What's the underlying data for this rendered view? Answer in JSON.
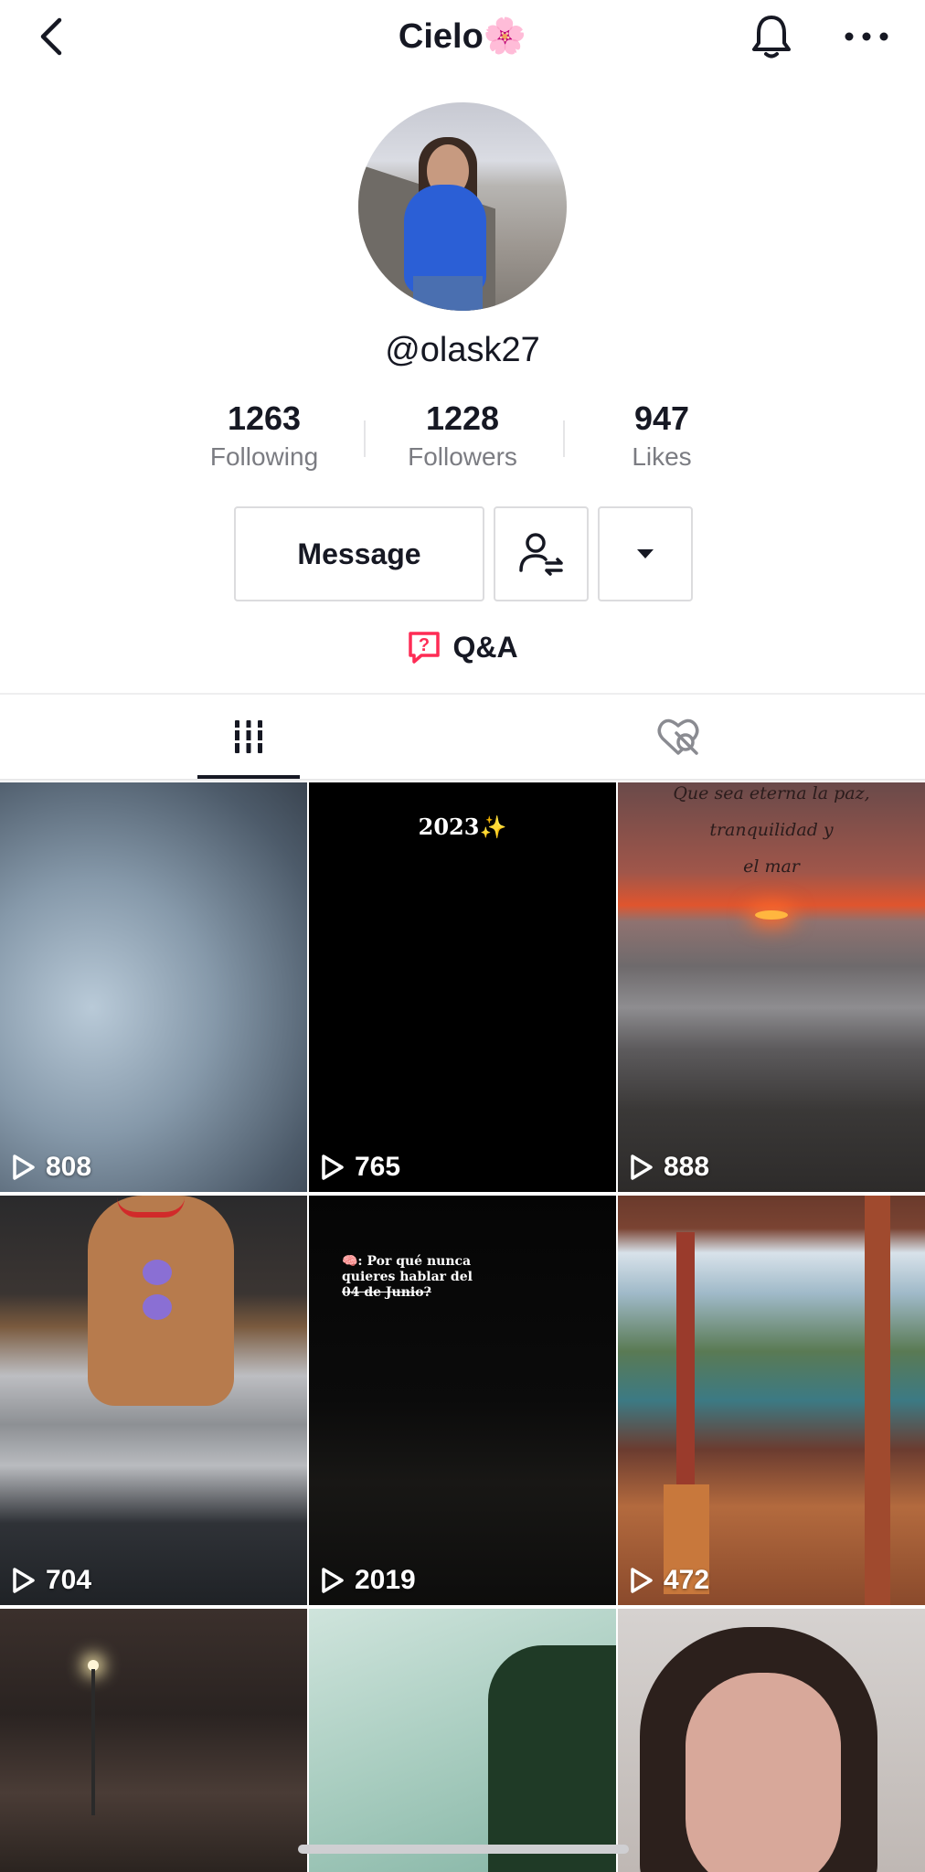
{
  "header": {
    "title": "Cielo🌸"
  },
  "profile": {
    "username": "@olask27",
    "stats": [
      {
        "value": "1263",
        "label": "Following"
      },
      {
        "value": "1228",
        "label": "Followers"
      },
      {
        "value": "947",
        "label": "Likes"
      }
    ]
  },
  "actions": {
    "message_label": "Message",
    "qa_label": "Q&A"
  },
  "tabs": [
    {
      "icon": "grid-icon",
      "active": true
    },
    {
      "icon": "liked-hidden-icon",
      "active": false
    }
  ],
  "videos": [
    {
      "views": "808",
      "overlay": ""
    },
    {
      "views": "765",
      "overlay": "2023✨"
    },
    {
      "views": "888",
      "overlay_lines": [
        "Que sea eterna la paz,",
        "tranquilidad y",
        "el mar"
      ]
    },
    {
      "views": "704",
      "overlay": ""
    },
    {
      "views": "2019",
      "overlay_lines": [
        "🧠: Por qué nunca",
        "quieres hablar del",
        "04 de Junio?"
      ]
    },
    {
      "views": "472",
      "overlay": ""
    },
    {
      "views": "",
      "overlay": ""
    },
    {
      "views": "",
      "overlay": ""
    },
    {
      "views": "",
      "overlay": ""
    }
  ],
  "colors": {
    "text_primary": "#161823",
    "text_secondary": "#7b7c82",
    "qa_accent": "#fe2c55"
  }
}
